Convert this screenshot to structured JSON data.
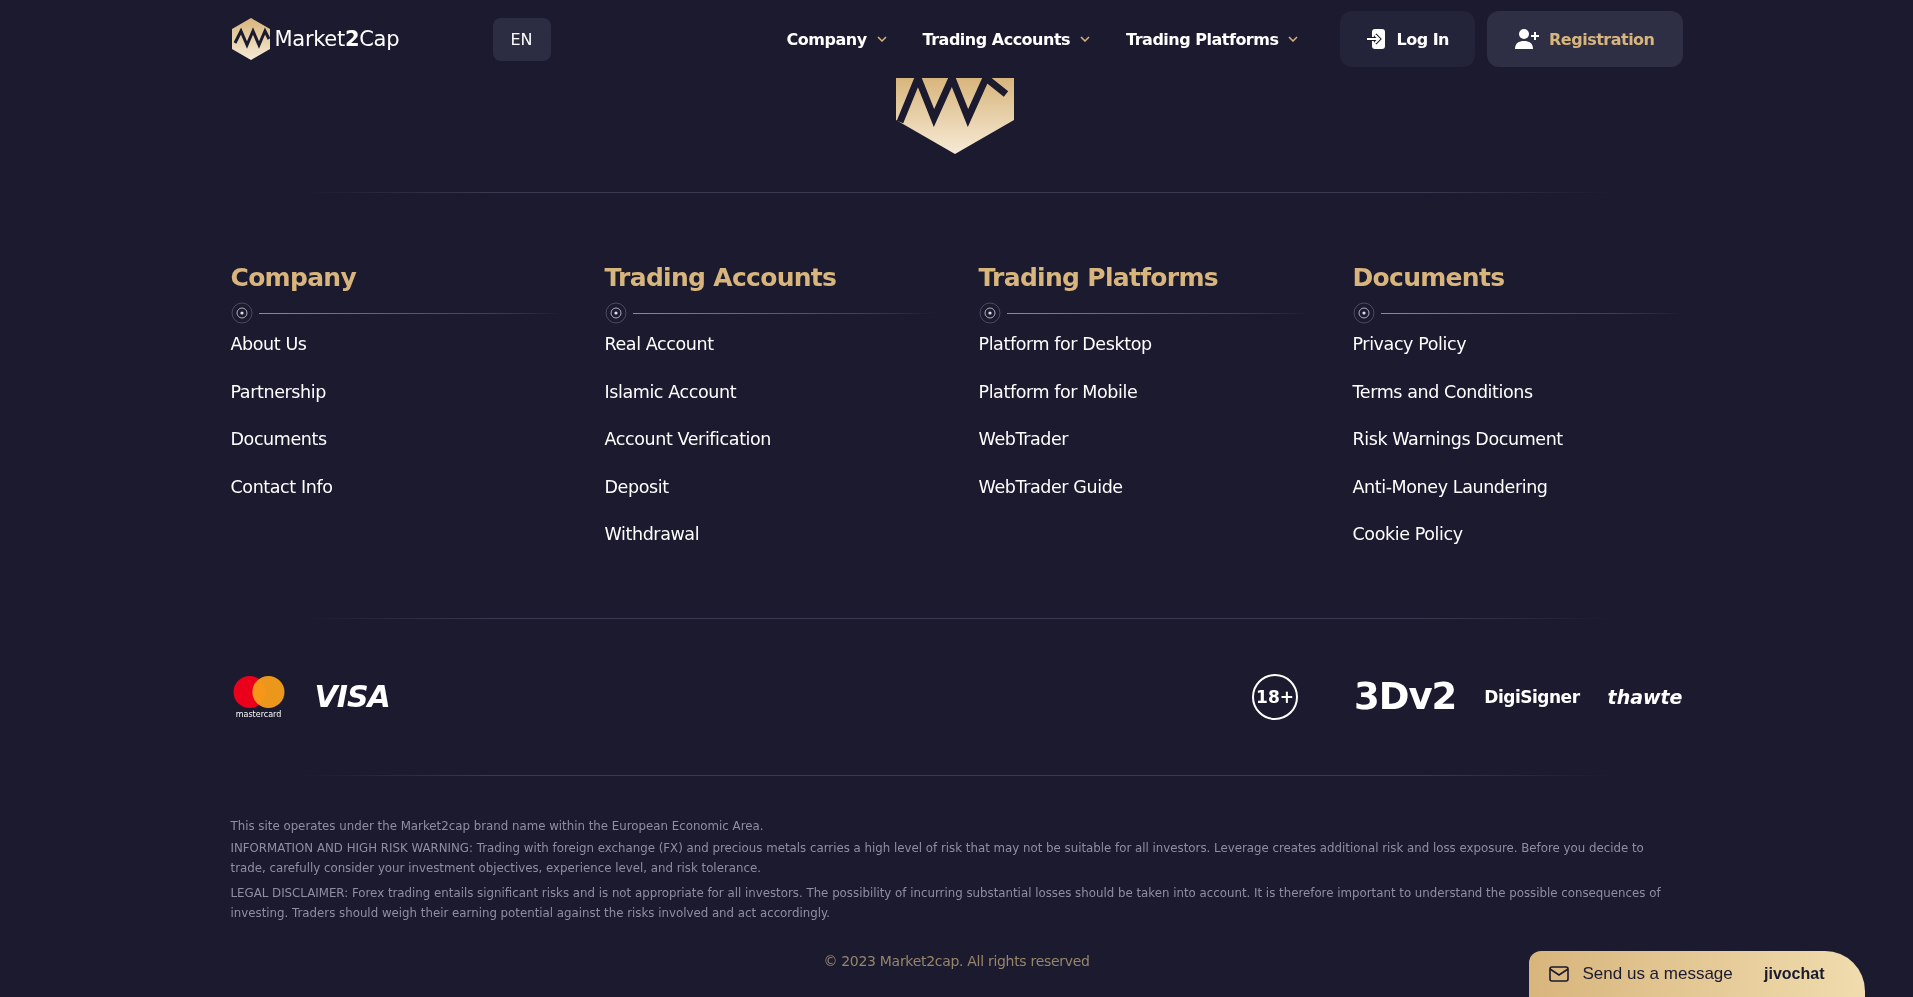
{
  "header": {
    "logo_text": "Market**2**Cap",
    "language": "EN",
    "nav": [
      {
        "label": "Company"
      },
      {
        "label": "Trading Accounts"
      },
      {
        "label": "Trading Platforms"
      }
    ],
    "login": "Log In",
    "registration": "Registration"
  },
  "columns": [
    {
      "title": "Company",
      "links": [
        "About Us",
        "Partnership",
        "Documents",
        "Contact Info"
      ]
    },
    {
      "title": "Trading Accounts",
      "links": [
        "Real Account",
        "Islamic Account",
        "Account Verification",
        "Deposit",
        "Withdrawal"
      ]
    },
    {
      "title": "Trading Platforms",
      "links": [
        "Platform for Desktop",
        "Platform for Mobile",
        "WebTrader",
        "WebTrader Guide"
      ]
    },
    {
      "title": "Documents",
      "links": [
        "Privacy Policy",
        "Terms and Conditions",
        "Risk Warnings Document",
        "Anti-Money Laundering",
        "Cookie Policy"
      ]
    }
  ],
  "badges": {
    "mastercard": "mastercard",
    "visa": "VISA",
    "age": "18+",
    "secure": "3Dv2",
    "digisigner": "DigiSigner",
    "thawte": "thawte"
  },
  "legal": [
    "This site operates under the Market2cap brand name within the European Economic Area.",
    "INFORMATION AND HIGH RISK WARNING: Trading with foreign exchange (FX) and precious metals carries a high level of risk that may not be suitable for all investors. Leverage creates additional risk and loss exposure. Before you decide to trade, carefully consider your investment objectives, experience level, and risk tolerance.",
    "LEGAL DISCLAIMER: Forex trading entails significant risks and is not appropriate for all investors. The possibility of incurring substantial losses should be taken into account. It is therefore important to understand the possible consequences of investing. Traders should weigh their earning potential against the risks involved and act accordingly."
  ],
  "copyright": "© 2023 Market2cap. All rights reserved",
  "chat": {
    "label": "Send us a message",
    "brand": "jivochat"
  }
}
